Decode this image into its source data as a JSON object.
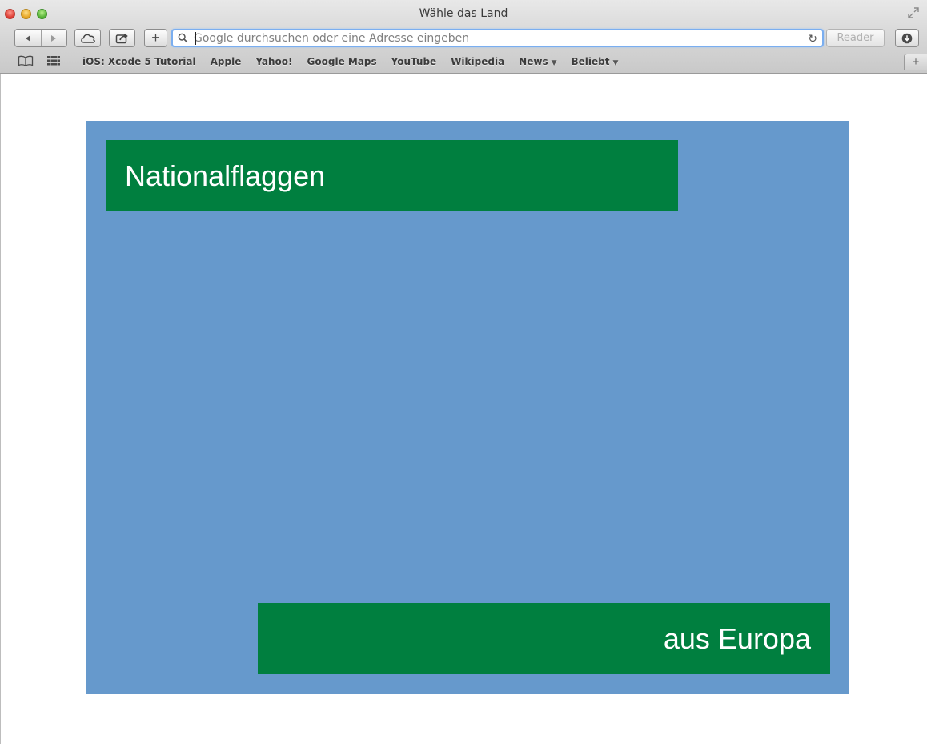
{
  "window": {
    "title": "Wähle das Land"
  },
  "toolbar": {
    "address_placeholder": "Google durchsuchen oder eine Adresse eingeben",
    "add_label": "+",
    "reload_glyph": "↻",
    "reader_label": "Reader"
  },
  "bookmarks": {
    "items": [
      {
        "label": "iOS: Xcode 5 Tutorial",
        "dropdown": false
      },
      {
        "label": "Apple",
        "dropdown": false
      },
      {
        "label": "Yahoo!",
        "dropdown": false
      },
      {
        "label": "Google Maps",
        "dropdown": false
      },
      {
        "label": "YouTube",
        "dropdown": false
      },
      {
        "label": "Wikipedia",
        "dropdown": false
      },
      {
        "label": "News",
        "dropdown": true
      },
      {
        "label": "Beliebt",
        "dropdown": true
      }
    ],
    "new_tab_label": "+"
  },
  "page": {
    "heading": "Nationalflaggen",
    "subheading": "aus Europa"
  },
  "colors": {
    "panel_background": "#6699cc",
    "banner_background": "#007f3f",
    "banner_text": "#ffffff",
    "address_focus": "#7aaef0"
  },
  "icons": [
    "close-window-icon",
    "minimize-window-icon",
    "maximize-window-icon",
    "fullscreen-icon",
    "back-icon",
    "forward-icon",
    "icloud-tabs-icon",
    "share-icon",
    "search-icon",
    "reload-icon",
    "download-icon",
    "reading-list-icon",
    "top-sites-icon"
  ]
}
